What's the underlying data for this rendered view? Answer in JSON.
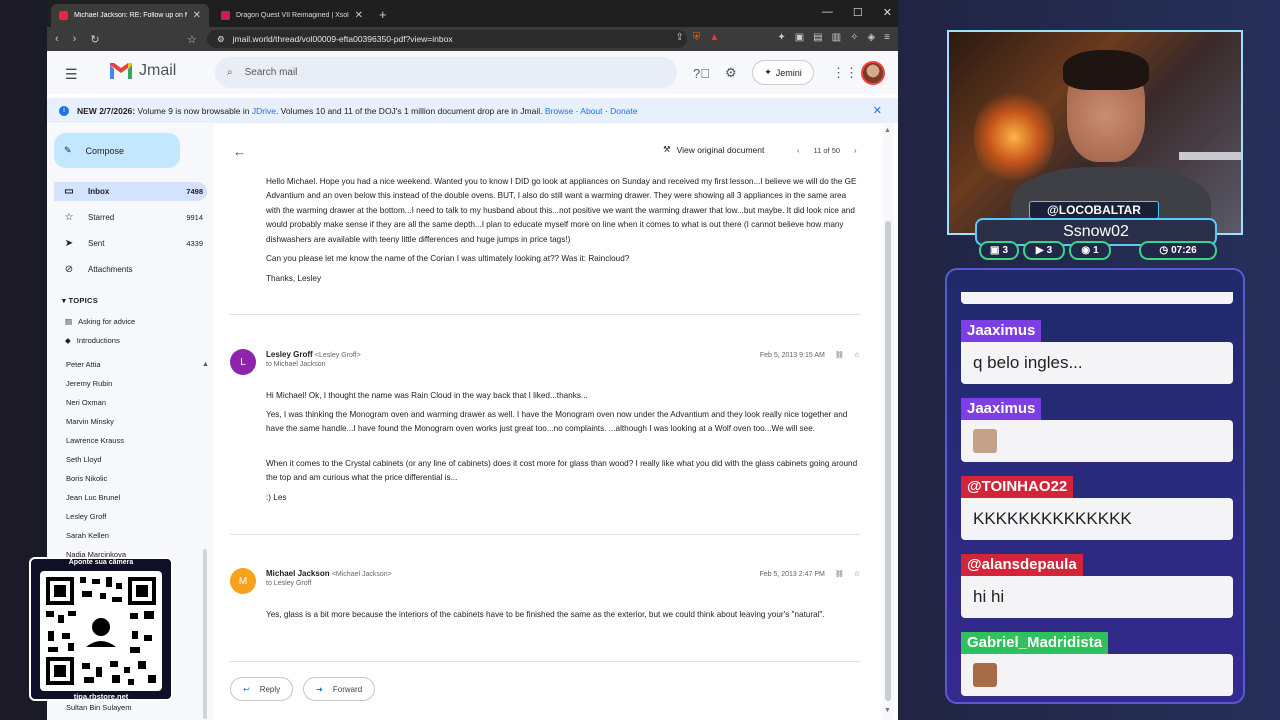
{
  "browser": {
    "tabs": [
      {
        "title": "Michael Jackson: RE: Follow up on Mee"
      },
      {
        "title": "Dragon Quest VII Reimagined | Xsolla Partner"
      }
    ],
    "url": "jmail.world/thread/vol00009-efta00396350-pdf?view=inbox"
  },
  "gmail": {
    "logo_text": "Jmail",
    "search_placeholder": "Search mail",
    "jemini_label": "Jemini",
    "banner": {
      "date": "NEW 2/7/2026:",
      "text1": "Volume 9 is now browsable in",
      "jdrive": "JDrive",
      "text2": ". Volumes 10 and 11 of the DOJ's 1 million document drop are in Jmail.",
      "browse": "Browse",
      "about": "About",
      "donate": "Donate"
    },
    "compose_label": "Compose",
    "folders": [
      {
        "label": "Inbox",
        "count": "7498",
        "icon": "inbox-icon"
      },
      {
        "label": "Starred",
        "count": "9914",
        "icon": "star-icon"
      },
      {
        "label": "Sent",
        "count": "4339",
        "icon": "send-icon"
      },
      {
        "label": "Attachments",
        "count": "",
        "icon": "paperclip-icon"
      }
    ],
    "topics_label": "TOPICS",
    "topics": [
      "Asking for advice",
      "Introductions"
    ],
    "people": [
      "Peter Attia",
      "Jeremy Rubin",
      "Neri Oxman",
      "Marvin Minsky",
      "Lawrence Krauss",
      "Seth Lloyd",
      "Boris Nikolic",
      "Jean Luc Brunel",
      "Lesley Groff",
      "Sarah Kellen",
      "Nadia Marcinkova",
      "Sultan Bin Sulayem"
    ]
  },
  "thread": {
    "view_original": "View original document",
    "pager": "11 of 50",
    "first_message": {
      "body1": "Hello Michael. Hope you had a nice weekend. Wanted you to know I DID go look at appliances on Sunday and received my first lesson...I believe we will do the GE Advantium and an oven below this instead of the double ovens. BUT, I also do still want a warming drawer. They were showing all 3 appliances in the same area with the warming drawer at the bottom...I need to talk to my husband about this...not positive we want the warming drawer that low...but maybe. It did look nice and would probably make sense if they are all the same depth...I plan to educate myself more on line when it comes to what is out there (I cannot believe how many dishwashers are available with teeny little differences and huge jumps in price tags!)",
      "body2": "Can you please let me know the name of the Corian I was ultimately looking at?? Was it: Raincloud?",
      "body3": "Thanks, Lesley"
    },
    "second_message": {
      "avatar_letter": "L",
      "sender": "Lesley Groff",
      "sender_email": "<Lesley Groff>",
      "to": "to Michael Jackson",
      "date": "Feb 5, 2013 9:15 AM",
      "body1": "Hi Michael! Ok, I thought the name was Rain Cloud in the way back that I liked...thanks...",
      "body2": "Yes, I was thinking the Monogram oven and warming drawer as well. I have the Monogram oven now under the Advantium and they look really nice together and have the same handle...I have found the Monogram oven works just great too...no complaints. ...although I was looking at a Wolf oven too...We will see.",
      "body3": "When it comes to the Crystal cabinets (or any line of cabinets) does it cost more for glass than wood? I really like what you did with the glass cabinets going around the top and am curious what the price differential is...",
      "body4": ":) Les"
    },
    "third_message": {
      "avatar_letter": "M",
      "sender": "Michael Jackson",
      "sender_email": "<Michael Jackson>",
      "to": "to Lesley Groff",
      "date": "Feb 5, 2013 2:47 PM",
      "body1": "Yes, glass is a bit more because the interiors of the cabinets have to be finished the same as the exterior, but we could think about leaving your's \"natural\"."
    },
    "reply_label": "Reply",
    "forward_label": "Forward"
  },
  "qr_overlay": {
    "caption": "Aponte sua câmera",
    "footer": "tipa.rbstore.net"
  },
  "stream": {
    "handle": "@LOCOBALTAR",
    "name": "Ssnow02",
    "stats": [
      "3",
      "3",
      "1",
      "07:26"
    ],
    "chat": [
      {
        "user": "Jaaximus",
        "text": "q belo ingles...",
        "color": "#7b3fe4"
      },
      {
        "user": "Jaaximus",
        "text": "",
        "color": "#7b3fe4"
      },
      {
        "user": "@TOINHAO22",
        "text": "KKKKKKKKKKKKKK",
        "color": "#d2253a"
      },
      {
        "user": "@alansdepaula",
        "text": "hi hi",
        "color": "#d2253a"
      },
      {
        "user": "Gabriel_Madridista",
        "text": "",
        "color": "#2fc25b"
      }
    ]
  }
}
